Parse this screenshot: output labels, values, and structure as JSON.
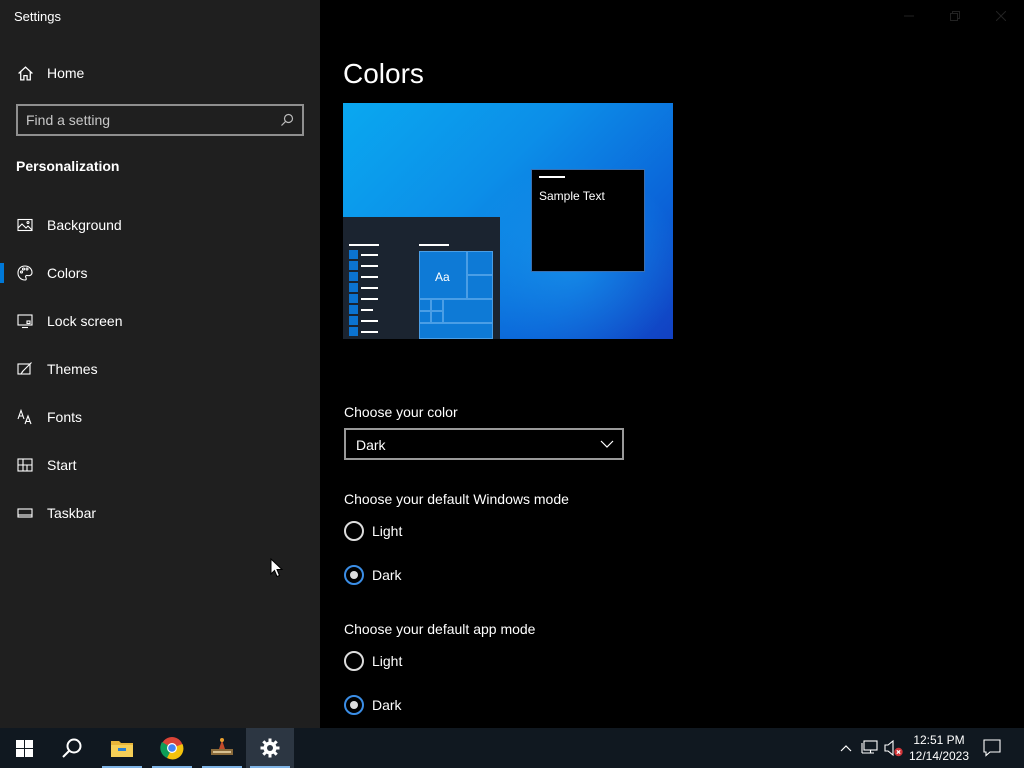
{
  "window": {
    "title": "Settings"
  },
  "sidebar": {
    "home_label": "Home",
    "search_placeholder": "Find a setting",
    "section_title": "Personalization",
    "items": [
      {
        "label": "Background",
        "icon": "picture-icon",
        "active": false
      },
      {
        "label": "Colors",
        "icon": "palette-icon",
        "active": true
      },
      {
        "label": "Lock screen",
        "icon": "lock-screen-icon",
        "active": false
      },
      {
        "label": "Themes",
        "icon": "themes-icon",
        "active": false
      },
      {
        "label": "Fonts",
        "icon": "fonts-icon",
        "active": false
      },
      {
        "label": "Start",
        "icon": "start-icon",
        "active": false
      },
      {
        "label": "Taskbar",
        "icon": "taskbar-icon",
        "active": false
      }
    ]
  },
  "main": {
    "title": "Colors",
    "preview": {
      "sample_text": "Sample Text",
      "tile_text": "Aa"
    },
    "choose_color": {
      "label": "Choose your color",
      "selected": "Dark"
    },
    "windows_mode": {
      "label": "Choose your default Windows mode",
      "options": [
        "Light",
        "Dark"
      ],
      "selected": "Dark"
    },
    "app_mode": {
      "label": "Choose your default app mode",
      "options": [
        "Light",
        "Dark"
      ],
      "selected": "Dark"
    }
  },
  "taskbar": {
    "apps": [
      "start-icon",
      "search-icon",
      "file-explorer-icon",
      "chrome-icon",
      "app-icon",
      "settings-icon"
    ],
    "clock": {
      "time": "12:51 PM",
      "date": "12/14/2023"
    }
  },
  "colors": {
    "accent": "#0078d7",
    "sidebar_bg": "#1f1f1f",
    "main_bg": "#000000",
    "taskbar_bg": "#101820"
  }
}
